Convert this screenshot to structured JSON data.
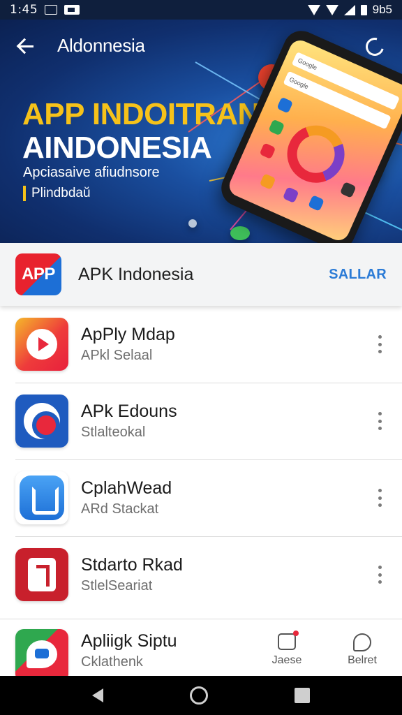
{
  "status_bar": {
    "time": "1:45",
    "right_text": "9b5",
    "icons": [
      "square-icon",
      "image-icon",
      "wifi-icon",
      "wifi-icon",
      "signal-icon",
      "battery-icon"
    ]
  },
  "hero": {
    "nav_title": "Aldonnesia",
    "headline_line1": "APP INDOITRAN",
    "headline_line2": "AINDONESIA",
    "subtitle": "Apciasaive afiudnsore",
    "tagline": "Plindbdaŭ",
    "phone_search_1": "Google",
    "phone_search_2": "Google",
    "colors": {
      "headline_accent": "#f6c21a",
      "background": "#102f6e"
    }
  },
  "featured": {
    "badge": "APP",
    "name": "APK Indonesia",
    "action": "SALLAR",
    "colors": {
      "action": "#2b7bd6",
      "badge_red": "#e8222e",
      "badge_blue": "#1d6fd6"
    }
  },
  "list": [
    {
      "title": "ApPly Mdap",
      "subtitle": "APkl Selaal",
      "icon": "play-icon"
    },
    {
      "title": "APk Edouns",
      "subtitle": "Stlalteokal",
      "icon": "globe-icon"
    },
    {
      "title": "CplahWead",
      "subtitle": "ARd Stackat",
      "icon": "home-icon"
    },
    {
      "title": "Stdarto Rkad",
      "subtitle": "StlelSeariat",
      "icon": "music-icon"
    }
  ],
  "last_row": {
    "title": "Apliigk Siptu",
    "subtitle": "Cklathenk",
    "icon": "chat-icon",
    "actions": [
      {
        "label": "Jaese",
        "icon": "notification-icon"
      },
      {
        "label": "Belret",
        "icon": "comment-icon"
      }
    ]
  },
  "nav_bar": {
    "buttons": [
      "back-icon",
      "home-icon",
      "recents-icon"
    ]
  }
}
